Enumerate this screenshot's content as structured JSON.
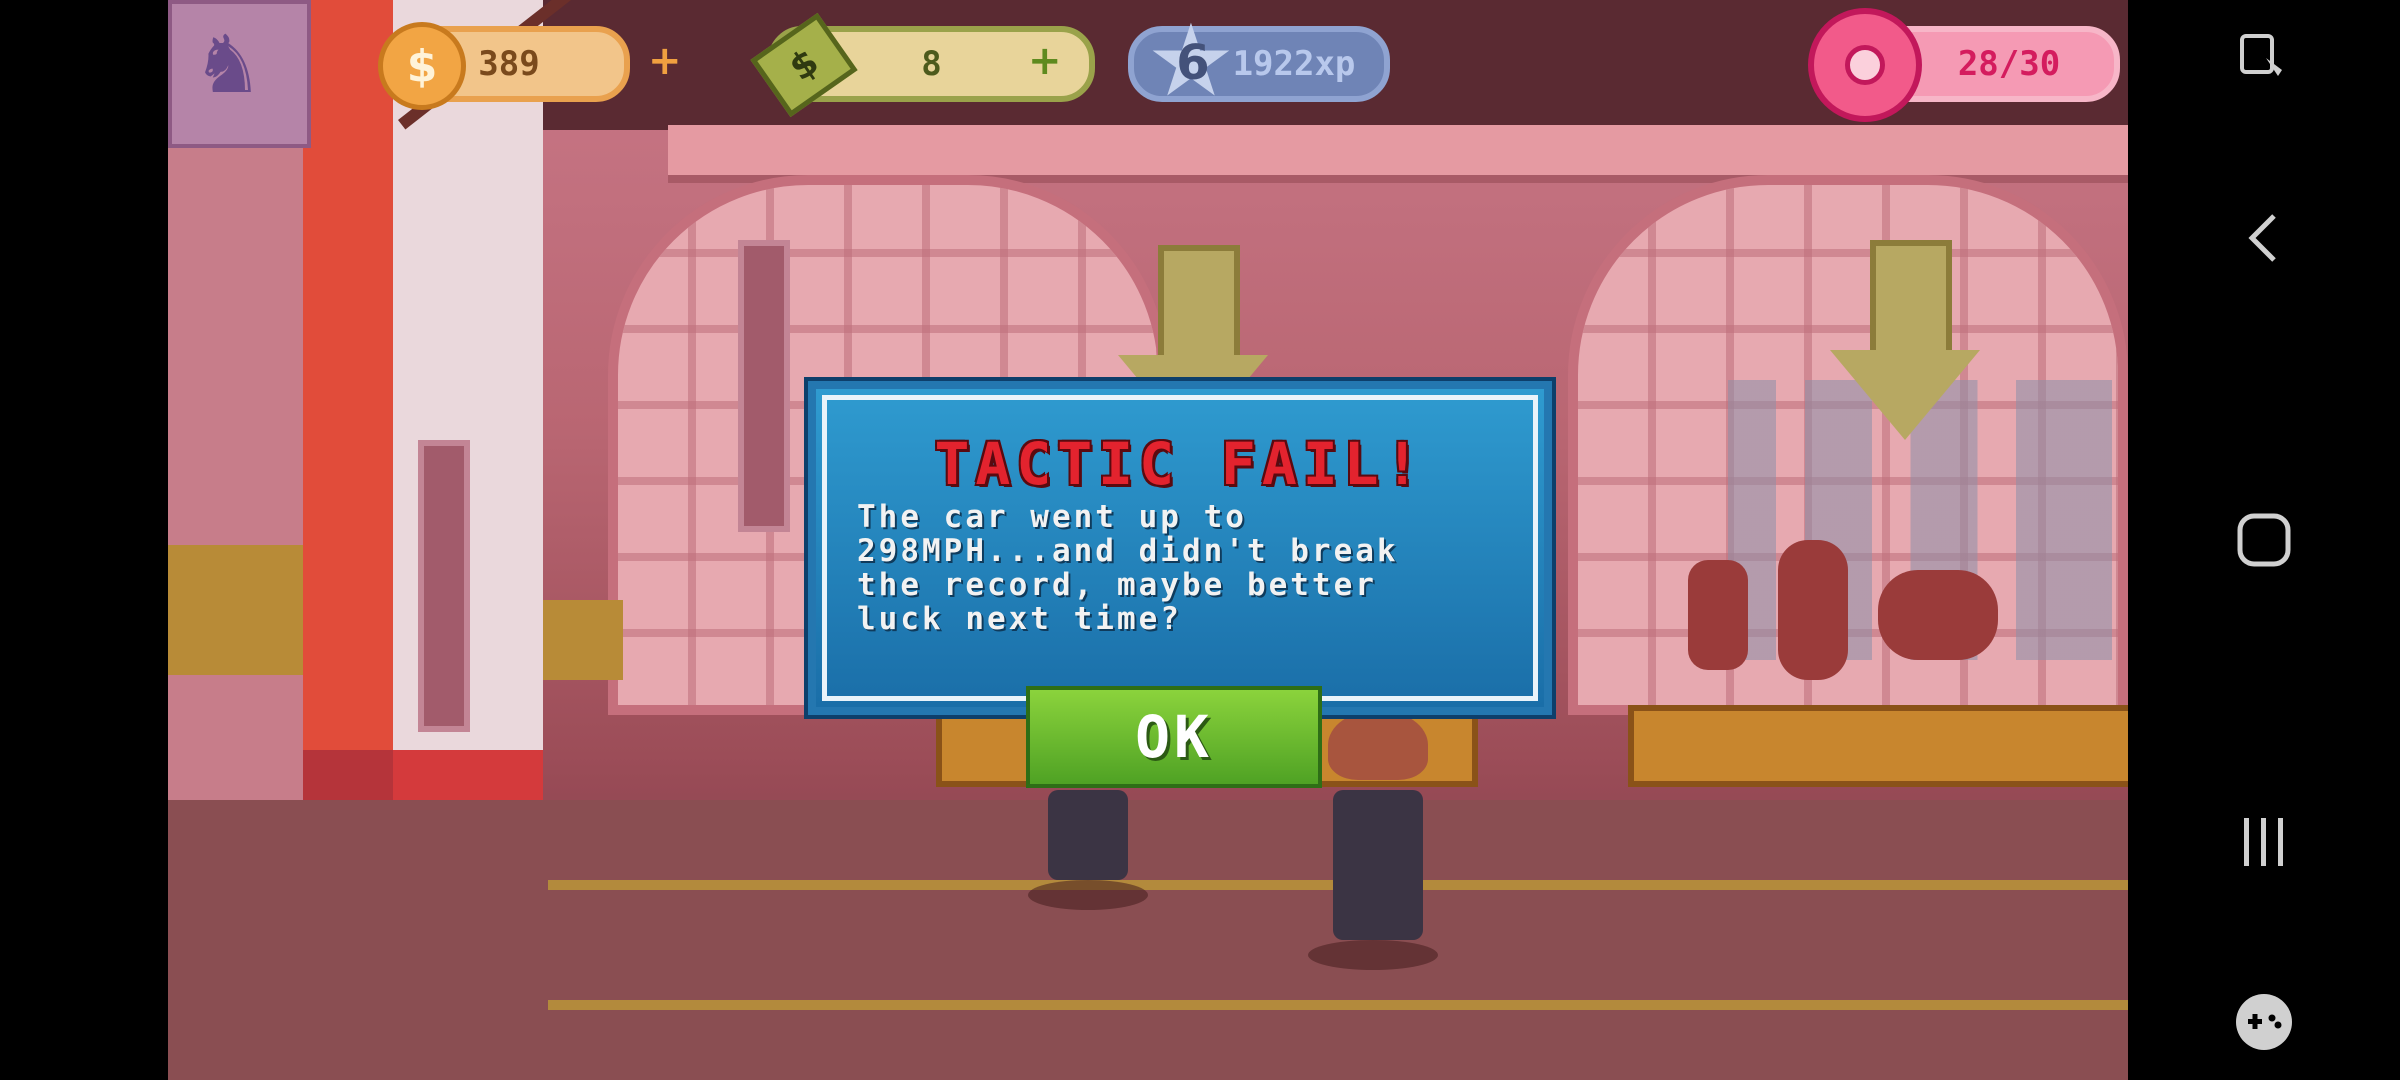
{
  "hud": {
    "coins": {
      "value": "389",
      "icon": "dollar-coin-icon",
      "plus": "+"
    },
    "cash": {
      "value": "8",
      "icon": "banknote-icon",
      "plus": "+"
    },
    "level": {
      "number": "6",
      "xp": "1922xp",
      "icon": "level-star-icon"
    },
    "donuts": {
      "value": "28/30",
      "icon": "donut-icon"
    }
  },
  "dialog": {
    "title": "TACTIC FAIL!",
    "message": "The car went up to\n298MPH...and didn't break\nthe record, maybe better\nluck next time?",
    "ok_label": "OK"
  },
  "colors": {
    "dialog_bg": "#1f7fbb",
    "title_red": "#e3232e",
    "ok_green": "#6cbf2e",
    "coin_orange": "#f2a544",
    "cash_green": "#9aa24a",
    "xp_blue": "#7d96c8",
    "donut_pink": "#f25a8a"
  }
}
